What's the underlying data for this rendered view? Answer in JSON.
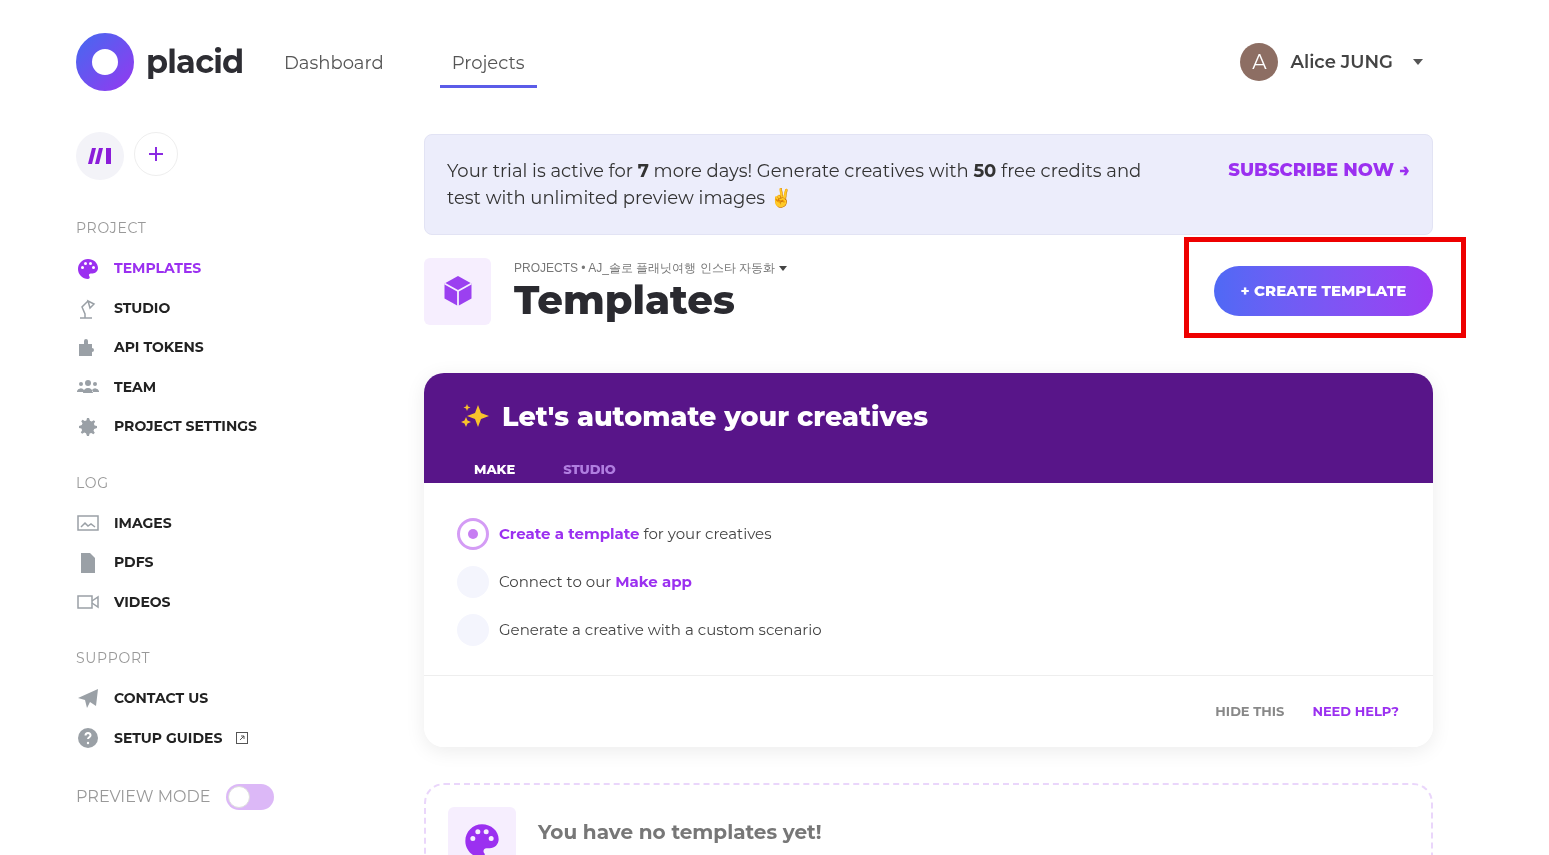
{
  "brand": {
    "name": "placid"
  },
  "nav": [
    {
      "label": "Dashboard",
      "selected": false
    },
    {
      "label": "Projects",
      "selected": true
    }
  ],
  "user": {
    "initial": "A",
    "name": "Alice JUNG"
  },
  "sidebar": {
    "sections": [
      {
        "title": "PROJECT",
        "items": [
          {
            "label": "TEMPLATES",
            "selected": true
          },
          {
            "label": "STUDIO",
            "selected": false
          },
          {
            "label": "API TOKENS",
            "selected": false
          },
          {
            "label": "TEAM",
            "selected": false
          },
          {
            "label": "PROJECT SETTINGS",
            "selected": false
          }
        ]
      },
      {
        "title": "LOG",
        "items": [
          {
            "label": "IMAGES",
            "selected": false
          },
          {
            "label": "PDFS",
            "selected": false
          },
          {
            "label": "VIDEOS",
            "selected": false
          }
        ]
      },
      {
        "title": "SUPPORT",
        "items": [
          {
            "label": "CONTACT US",
            "selected": false
          },
          {
            "label": "SETUP GUIDES",
            "selected": false,
            "external": true
          }
        ]
      }
    ],
    "preview_mode": {
      "label": "PREVIEW MODE",
      "on": false
    }
  },
  "trial_banner": {
    "text": "Your trial is active for **7** more days! Generate creatives with **50** free credits and test with unlimited preview images ✌",
    "action": "SUBSCRIBE NOW →"
  },
  "page": {
    "breadcrumb": "PROJECTS • AJ_솔로 플래닛여행 인스타 자동화",
    "title": "Templates",
    "create_button": "+ CREATE TEMPLATE"
  },
  "onboarding": {
    "title": "Let's automate your creatives",
    "tabs": [
      {
        "label": "MAKE",
        "selected": true
      },
      {
        "label": "STUDIO",
        "selected": false
      }
    ],
    "steps": [
      {
        "text": "**Create a template** for your creatives",
        "active": true
      },
      {
        "text": "Connect to our **Make app**",
        "active": false
      },
      {
        "text": "Generate a creative with a custom scenario",
        "active": false
      }
    ],
    "hide": "HIDE THIS",
    "help": "NEED HELP?"
  },
  "empty_state": {
    "title": "You have no templates yet!"
  }
}
